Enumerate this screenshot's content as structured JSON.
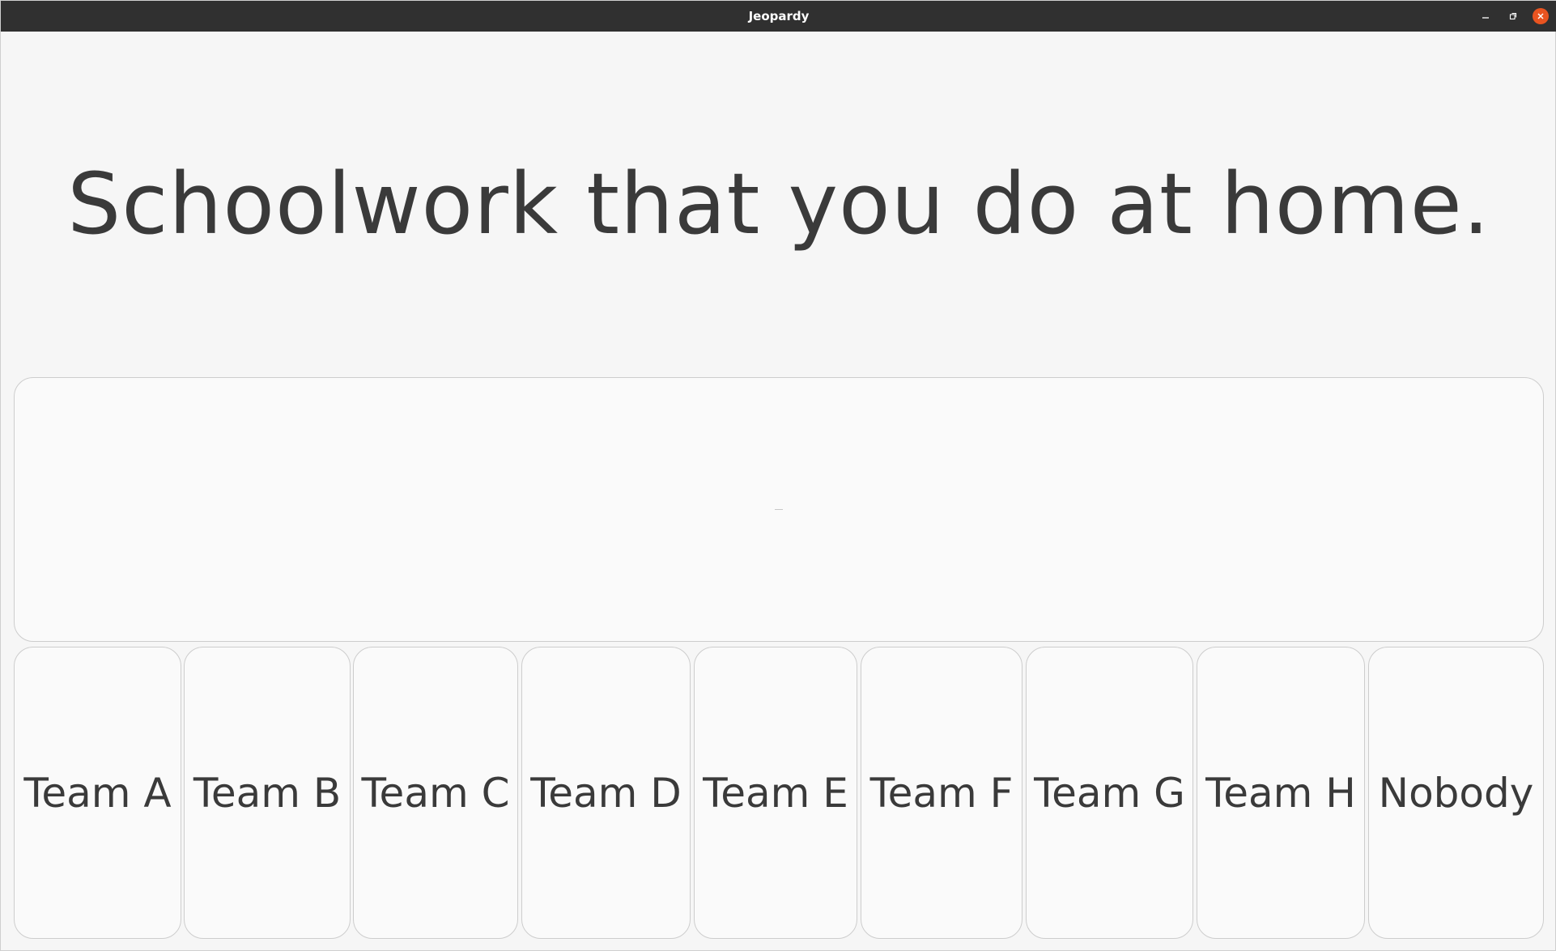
{
  "window": {
    "title": "Jeopardy"
  },
  "question": {
    "text": "Schoolwork that you do at home."
  },
  "answer": {
    "text": ""
  },
  "teams": [
    {
      "label": "Team A"
    },
    {
      "label": "Team B"
    },
    {
      "label": "Team C"
    },
    {
      "label": "Team D"
    },
    {
      "label": "Team E"
    },
    {
      "label": "Team F"
    },
    {
      "label": "Team G"
    },
    {
      "label": "Team H"
    },
    {
      "label": "Nobody"
    }
  ],
  "colors": {
    "titlebar": "#303030",
    "close_button": "#e95420",
    "background": "#f6f6f6",
    "text": "#3a3a3a"
  }
}
